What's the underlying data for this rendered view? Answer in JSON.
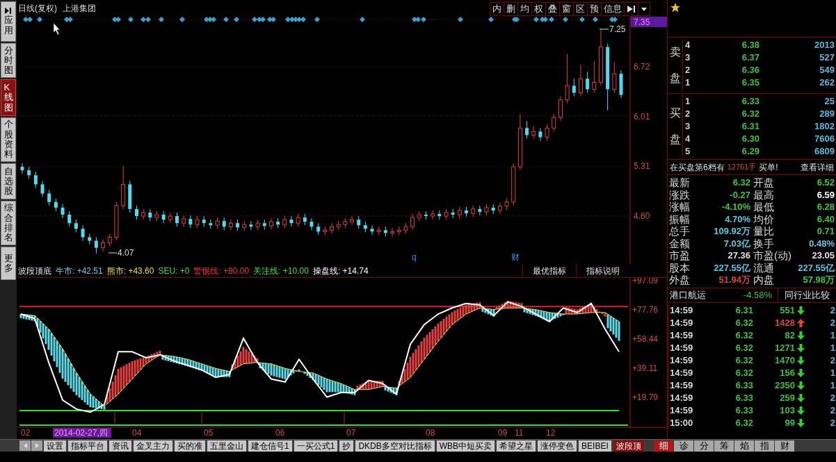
{
  "sidebar": {
    "items": [
      {
        "label": "应用",
        "selected": false
      },
      {
        "label": "分时图",
        "selected": false
      },
      {
        "label": "K线图",
        "selected": true
      },
      {
        "label": "个股资料",
        "selected": false
      },
      {
        "label": "自选股",
        "selected": false
      },
      {
        "label": "综合排名",
        "selected": false
      },
      {
        "label": "更多",
        "selected": false
      }
    ]
  },
  "chart": {
    "title": "日线(复权)",
    "stock": "上港集团",
    "toolbar": [
      "内",
      "删",
      "均",
      "权",
      "叠",
      "窗",
      "区",
      "预",
      "信息"
    ],
    "cursor_price": "7.35",
    "chart_data": {
      "type": "candlestick",
      "ylim": [
        3.92,
        7.45
      ],
      "yticks": [
        {
          "value": 6.72,
          "label": "6.72"
        },
        {
          "value": 6.01,
          "label": "6.01"
        },
        {
          "value": 5.31,
          "label": "5.31"
        },
        {
          "value": 4.6,
          "label": "4.60"
        }
      ],
      "ohlc": [
        [
          5.3,
          5.35,
          5.2,
          5.25
        ],
        [
          5.25,
          5.3,
          5.13,
          5.18
        ],
        [
          5.18,
          5.23,
          5.0,
          5.05
        ],
        [
          5.05,
          5.1,
          4.87,
          4.92
        ],
        [
          4.92,
          4.97,
          4.75,
          4.8
        ],
        [
          4.8,
          4.85,
          4.67,
          4.72
        ],
        [
          4.72,
          4.77,
          4.57,
          4.62
        ],
        [
          4.62,
          4.67,
          4.45,
          4.5
        ],
        [
          4.5,
          4.55,
          4.37,
          4.42
        ],
        [
          4.42,
          4.47,
          4.25,
          4.3
        ],
        [
          4.3,
          4.35,
          4.2,
          4.25
        ],
        [
          4.25,
          4.3,
          4.07,
          4.15
        ],
        [
          4.15,
          4.27,
          4.1,
          4.22
        ],
        [
          4.22,
          4.35,
          4.17,
          4.3
        ],
        [
          4.3,
          4.8,
          4.25,
          4.75
        ],
        [
          4.75,
          5.31,
          4.7,
          5.05
        ],
        [
          5.05,
          5.1,
          4.65,
          4.7
        ],
        [
          4.7,
          4.75,
          4.55,
          4.6
        ],
        [
          4.6,
          4.7,
          4.55,
          4.65
        ],
        [
          4.65,
          4.7,
          4.53,
          4.58
        ],
        [
          4.58,
          4.67,
          4.53,
          4.62
        ],
        [
          4.62,
          4.67,
          4.5,
          4.55
        ],
        [
          4.55,
          4.65,
          4.5,
          4.6
        ],
        [
          4.6,
          4.65,
          4.45,
          4.5
        ],
        [
          4.5,
          4.61,
          4.45,
          4.56
        ],
        [
          4.56,
          4.61,
          4.43,
          4.48
        ],
        [
          4.48,
          4.6,
          4.43,
          4.55
        ],
        [
          4.55,
          4.6,
          4.45,
          4.5
        ],
        [
          4.5,
          4.55,
          4.42,
          4.47
        ],
        [
          4.47,
          4.58,
          4.42,
          4.53
        ],
        [
          4.53,
          4.58,
          4.4,
          4.45
        ],
        [
          4.45,
          4.55,
          4.4,
          4.5
        ],
        [
          4.5,
          4.55,
          4.39,
          4.44
        ],
        [
          4.44,
          4.53,
          4.39,
          4.48
        ],
        [
          4.48,
          4.53,
          4.4,
          4.45
        ],
        [
          4.45,
          4.55,
          4.4,
          4.5
        ],
        [
          4.5,
          4.55,
          4.41,
          4.46
        ],
        [
          4.46,
          4.57,
          4.41,
          4.52
        ],
        [
          4.52,
          4.57,
          4.43,
          4.48
        ],
        [
          4.48,
          4.6,
          4.43,
          4.55
        ],
        [
          4.55,
          4.6,
          4.45,
          4.5
        ],
        [
          4.5,
          4.63,
          4.45,
          4.58
        ],
        [
          4.58,
          4.63,
          4.47,
          4.52
        ],
        [
          4.52,
          4.57,
          4.4,
          4.45
        ],
        [
          4.45,
          4.5,
          4.33,
          4.38
        ],
        [
          4.38,
          4.45,
          4.33,
          4.4
        ],
        [
          4.4,
          4.5,
          4.35,
          4.45
        ],
        [
          4.45,
          4.53,
          4.4,
          4.48
        ],
        [
          4.48,
          4.57,
          4.43,
          4.52
        ],
        [
          4.52,
          4.6,
          4.47,
          4.55
        ],
        [
          4.55,
          4.6,
          4.42,
          4.47
        ],
        [
          4.47,
          4.52,
          4.37,
          4.42
        ],
        [
          4.42,
          4.47,
          4.33,
          4.38
        ],
        [
          4.38,
          4.45,
          4.33,
          4.4
        ],
        [
          4.4,
          4.45,
          4.31,
          4.36
        ],
        [
          4.36,
          4.43,
          4.31,
          4.38
        ],
        [
          4.38,
          4.45,
          4.33,
          4.4
        ],
        [
          4.4,
          4.5,
          4.35,
          4.45
        ],
        [
          4.45,
          4.63,
          4.4,
          4.58
        ],
        [
          4.58,
          4.67,
          4.53,
          4.62
        ],
        [
          4.62,
          4.67,
          4.55,
          4.6
        ],
        [
          4.6,
          4.68,
          4.55,
          4.63
        ],
        [
          4.63,
          4.68,
          4.55,
          4.6
        ],
        [
          4.6,
          4.7,
          4.55,
          4.65
        ],
        [
          4.65,
          4.7,
          4.57,
          4.62
        ],
        [
          4.62,
          4.73,
          4.57,
          4.68
        ],
        [
          4.68,
          4.73,
          4.59,
          4.64
        ],
        [
          4.64,
          4.75,
          4.59,
          4.7
        ],
        [
          4.7,
          4.75,
          4.61,
          4.66
        ],
        [
          4.66,
          4.77,
          4.61,
          4.72
        ],
        [
          4.72,
          4.77,
          4.63,
          4.68
        ],
        [
          4.68,
          4.79,
          4.63,
          4.74
        ],
        [
          4.74,
          4.85,
          4.69,
          4.8
        ],
        [
          4.8,
          5.35,
          4.75,
          5.3
        ],
        [
          5.3,
          6.05,
          5.25,
          5.85
        ],
        [
          5.85,
          5.95,
          5.7,
          5.75
        ],
        [
          5.75,
          5.88,
          5.7,
          5.8
        ],
        [
          5.8,
          5.85,
          5.67,
          5.72
        ],
        [
          5.72,
          5.9,
          5.67,
          5.85
        ],
        [
          5.85,
          6.05,
          5.8,
          6.0
        ],
        [
          6.0,
          6.3,
          5.95,
          6.25
        ],
        [
          6.25,
          6.9,
          6.2,
          6.45
        ],
        [
          6.45,
          6.55,
          6.3,
          6.35
        ],
        [
          6.35,
          6.75,
          6.3,
          6.55
        ],
        [
          6.55,
          6.65,
          6.35,
          6.4
        ],
        [
          6.4,
          6.8,
          6.35,
          6.5
        ],
        [
          6.5,
          7.25,
          6.45,
          7.0
        ],
        [
          7.0,
          7.05,
          6.1,
          6.4
        ],
        [
          6.4,
          6.78,
          6.35,
          6.62
        ],
        [
          6.62,
          6.67,
          6.28,
          6.32
        ]
      ]
    },
    "high_label": "7.25",
    "low_label": "4.07",
    "markers": [
      "q",
      "财"
    ]
  },
  "indicator": {
    "legend": [
      {
        "text": "波段顶底"
      },
      {
        "text": "牛市: +42.51",
        "color": "#6fd0e8"
      },
      {
        "text": "熊市: +43.60",
        "color": "#e8e050"
      },
      {
        "text": "SEU: +0",
        "color": "#40e040"
      },
      {
        "text": "警惕线: +80.00",
        "color": "#f03030"
      },
      {
        "text": "关注线: +10.00",
        "color": "#40e040"
      },
      {
        "text": "操盘线: +14.74",
        "color": "#ffffff"
      }
    ],
    "buttons": [
      "最优指标",
      "指标说明"
    ],
    "chart_data": {
      "type": "line",
      "ylim": [
        0,
        98.93
      ],
      "yticks": [
        {
          "value": 97.09,
          "label": "+97.09"
        },
        {
          "value": 77.76,
          "label": "+77.76"
        },
        {
          "value": 58.44,
          "label": "+58.44"
        },
        {
          "value": 39.11,
          "label": "+39.11"
        },
        {
          "value": 19.79,
          "label": "+19.79"
        }
      ],
      "series": [
        {
          "color": "#ffffff",
          "values": [
            75,
            72,
            43,
            18,
            12,
            10,
            15,
            50,
            50,
            46,
            48,
            44,
            41,
            38,
            33,
            35,
            59,
            43,
            32,
            30,
            45,
            32,
            20,
            23,
            23,
            31,
            29,
            22,
            55,
            68,
            75,
            79,
            82,
            81,
            74,
            83,
            80,
            75,
            70,
            79,
            76,
            82,
            65,
            50
          ]
        },
        {
          "color": "#e8e050",
          "values": [
            75,
            74,
            65,
            52,
            36,
            22,
            14,
            22,
            32,
            42,
            48,
            47,
            45,
            42,
            39,
            37,
            42,
            43,
            42,
            39,
            37,
            36,
            32,
            29,
            25,
            25,
            27,
            26,
            33,
            45,
            57,
            68,
            75,
            79,
            78,
            79,
            79,
            78,
            76,
            75,
            75,
            76,
            76,
            70
          ]
        }
      ]
    },
    "dates": [
      {
        "label": "02",
        "selected": false
      },
      {
        "label": "2014-02-27,四",
        "selected": true
      },
      {
        "label": "04",
        "selected": false
      },
      {
        "label": "05",
        "selected": false
      },
      {
        "label": "06",
        "selected": false
      },
      {
        "label": "07",
        "selected": false
      },
      {
        "label": "08",
        "selected": false
      },
      {
        "label": "09",
        "selected": false
      },
      {
        "label": "11",
        "selected": false
      },
      {
        "label": "12",
        "selected": false
      }
    ]
  },
  "formula_tabs": [
    {
      "label": "设置",
      "selected": false
    },
    {
      "label": "指标平台",
      "selected": false
    },
    {
      "label": "资讯",
      "selected": false
    },
    {
      "label": "金叉主力",
      "selected": false
    },
    {
      "label": "买的准",
      "selected": false
    },
    {
      "label": "五里金山",
      "selected": false
    },
    {
      "label": "建仓信号1",
      "selected": false
    },
    {
      "label": "一买公式1",
      "selected": false
    },
    {
      "label": "抄",
      "selected": false
    },
    {
      "label": "DKDB多空对比指标",
      "selected": false
    },
    {
      "label": "WBB中短买卖",
      "selected": false
    },
    {
      "label": "希望之星",
      "selected": false
    },
    {
      "label": "涨停变色",
      "selected": false
    },
    {
      "label": "BEIBEI",
      "selected": false
    },
    {
      "label": "波段顶",
      "selected": true
    }
  ],
  "quote": {
    "sell_label": "卖盘",
    "sell": [
      {
        "level": "4",
        "price": "6.38",
        "volume": "2013"
      },
      {
        "level": "3",
        "price": "6.37",
        "volume": "527"
      },
      {
        "level": "2",
        "price": "6.36",
        "volume": "549"
      },
      {
        "level": "1",
        "price": "6.35",
        "volume": "262"
      }
    ],
    "buy_label": "买盘",
    "buy": [
      {
        "level": "1",
        "price": "6.33",
        "volume": "25"
      },
      {
        "level": "2",
        "price": "6.32",
        "volume": "289"
      },
      {
        "level": "3",
        "price": "6.31",
        "volume": "1802"
      },
      {
        "level": "4",
        "price": "6.30",
        "volume": "7606"
      },
      {
        "level": "5",
        "price": "6.29",
        "volume": "6809"
      }
    ],
    "note": {
      "prefix": "在买盘第6档有",
      "amount": "12761手",
      "suffix": "买单!",
      "link": "查看详细"
    },
    "stats": [
      {
        "label": "最新",
        "value": "6.32",
        "color": "#3cc83c"
      },
      {
        "label": "开盘",
        "value": "6.52",
        "color": "#3cc83c"
      },
      {
        "label": "涨跌",
        "value": "-0.27",
        "color": "#3cc83c"
      },
      {
        "label": "最高",
        "value": "6.59",
        "color": "#ffffff"
      },
      {
        "label": "涨幅",
        "value": "-4.10%",
        "color": "#3cc83c"
      },
      {
        "label": "最低",
        "value": "6.28",
        "color": "#3cc83c"
      },
      {
        "label": "振幅",
        "value": "4.70%",
        "color": "#5ac8e6"
      },
      {
        "label": "均价",
        "value": "6.40",
        "color": "#3cc83c"
      },
      {
        "label": "总手",
        "value": "109.92万",
        "color": "#5ac8e6"
      },
      {
        "label": "量比",
        "value": "0.71",
        "color": "#3cc83c"
      },
      {
        "label": "金额",
        "value": "7.03亿",
        "color": "#5ac8e6"
      },
      {
        "label": "换手",
        "value": "0.48%",
        "color": "#5ac8e6"
      },
      {
        "label": "市盈",
        "value": "27.36",
        "color": "#e0e0e0"
      },
      {
        "label": "市盈(动)",
        "value": "23.05",
        "color": "#e0e0e0"
      },
      {
        "label": "股本",
        "value": "227.55亿",
        "color": "#5ac8e6"
      },
      {
        "label": "流通",
        "value": "227.55亿",
        "color": "#5ac8e6"
      },
      {
        "label": "外盘",
        "value": "51.94万",
        "color": "#e04040"
      },
      {
        "label": "内盘",
        "value": "57.98万",
        "color": "#3cc83c"
      }
    ],
    "sector": {
      "name": "港口航运",
      "change": "-4.58%",
      "button": "同行业比较"
    },
    "ticks": [
      {
        "time": "14:59",
        "price": "6.31",
        "volume": "551",
        "kind": "down",
        "column_4": "2"
      },
      {
        "time": "14:59",
        "price": "6.32",
        "volume": "1428",
        "kind": "up",
        "column_4": "2"
      },
      {
        "time": "14:59",
        "price": "6.32",
        "volume": "82",
        "kind": "down",
        "column_4": "1"
      },
      {
        "time": "14:59",
        "price": "6.32",
        "volume": "1271",
        "kind": "down",
        "column_4": "1"
      },
      {
        "time": "14:59",
        "price": "6.32",
        "volume": "1470",
        "kind": "down",
        "column_4": "2"
      },
      {
        "time": "14:59",
        "price": "6.32",
        "volume": "156",
        "kind": "down",
        "column_4": "1"
      },
      {
        "time": "14:59",
        "price": "6.33",
        "volume": "2350",
        "kind": "down",
        "column_4": "1"
      },
      {
        "time": "14:59",
        "price": "6.33",
        "volume": "259",
        "kind": "down",
        "column_4": "2"
      },
      {
        "time": "14:59",
        "price": "6.33",
        "volume": "103",
        "kind": "down",
        "column_4": "2"
      },
      {
        "time": "15:00",
        "price": "6.32",
        "volume": "99",
        "kind": "down",
        "column_4": "2"
      }
    ],
    "tabs": [
      {
        "label": "细",
        "selected": true
      },
      {
        "label": "诊",
        "selected": false
      },
      {
        "label": "分",
        "selected": false
      },
      {
        "label": "筹",
        "selected": false
      },
      {
        "label": "焰",
        "selected": false
      },
      {
        "label": "指",
        "selected": false
      },
      {
        "label": "财",
        "selected": false
      }
    ]
  }
}
